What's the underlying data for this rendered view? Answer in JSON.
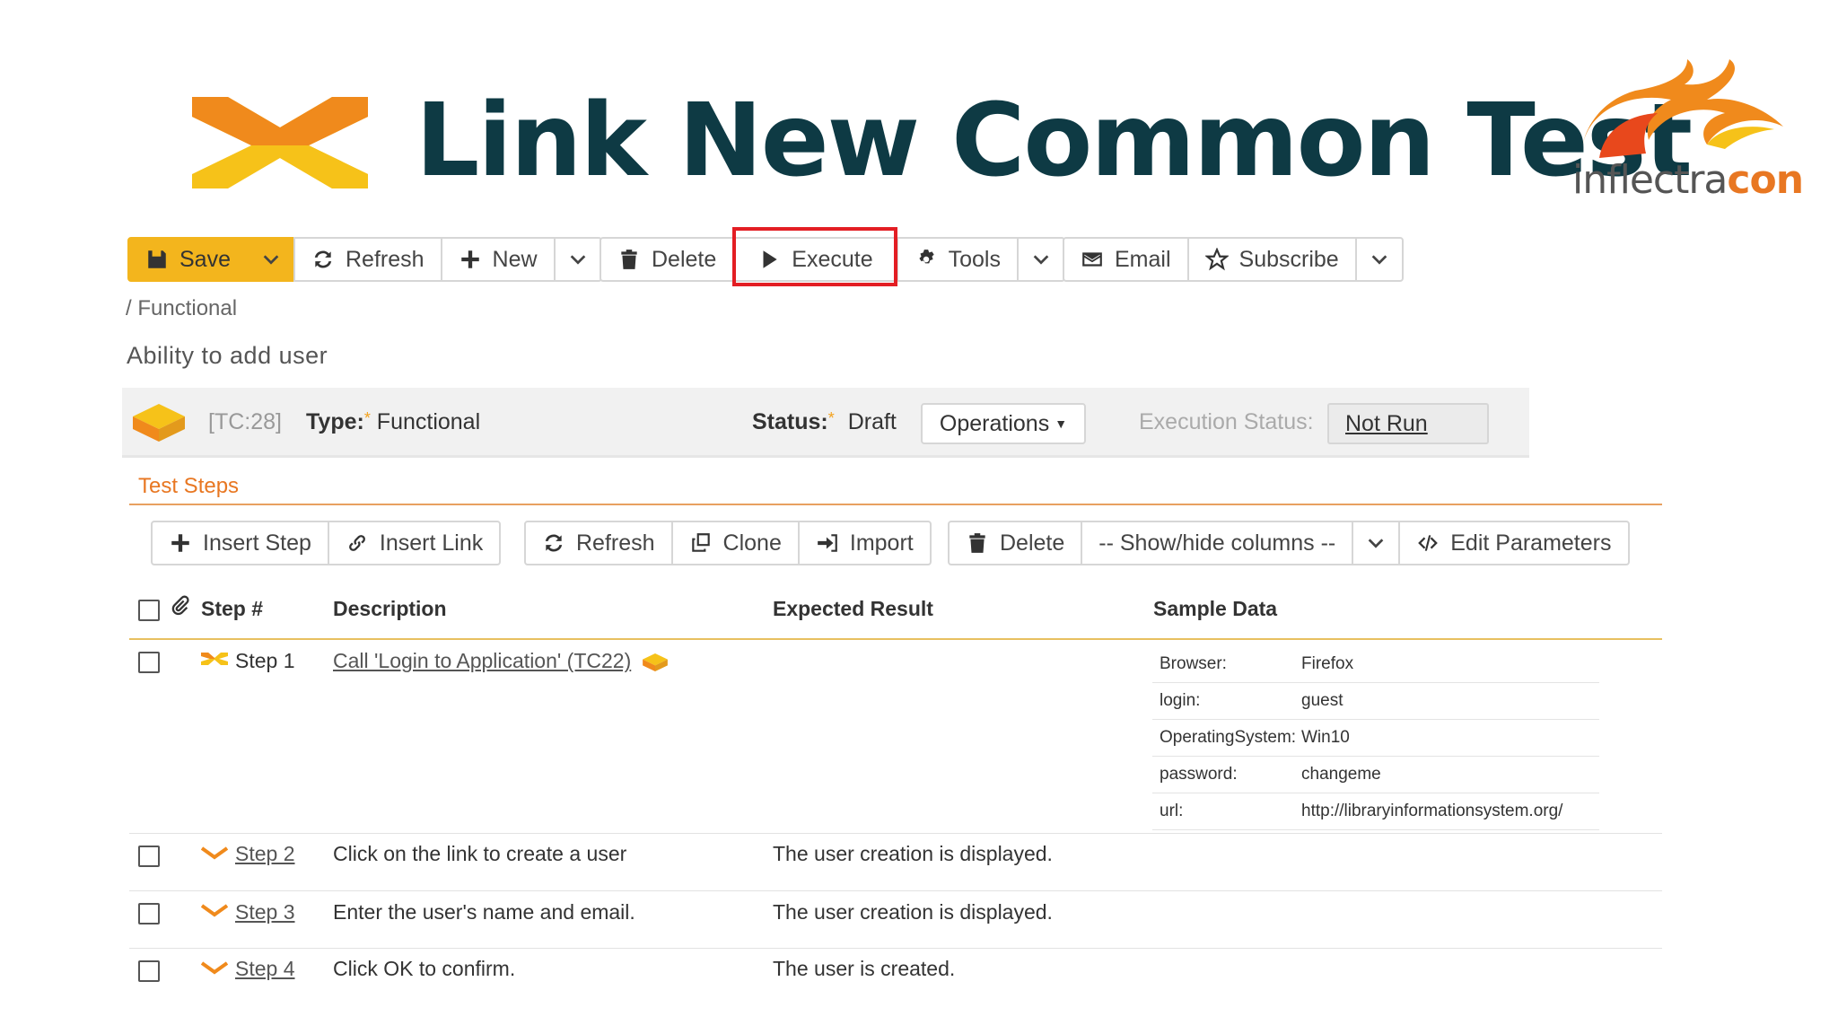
{
  "header": {
    "title": "Link New Common Test",
    "brand_logo": {
      "text_primary": "inflectra",
      "text_accent": "con",
      "colors": {
        "text": "#555555",
        "accent": "#e87722",
        "flame": "#f5a623"
      }
    }
  },
  "toolbar": {
    "save": "Save",
    "refresh": "Refresh",
    "new": "New",
    "delete": "Delete",
    "execute": "Execute",
    "tools": "Tools",
    "email": "Email",
    "subscribe": "Subscribe"
  },
  "breadcrumb": "/ Functional",
  "test_name": "Ability to add user",
  "info": {
    "id": "[TC:28]",
    "type_label": "Type:",
    "type_value": "Functional",
    "status_label": "Status:",
    "status_value": "Draft",
    "operations": "Operations",
    "execution_status_label": "Execution Status:",
    "execution_status_value": "Not Run"
  },
  "steps_tab": "Test Steps",
  "steps_toolbar": {
    "insert_step": "Insert Step",
    "insert_link": "Insert Link",
    "refresh": "Refresh",
    "clone": "Clone",
    "import": "Import",
    "delete": "Delete",
    "show_hide": "-- Show/hide columns --",
    "edit_parameters": "Edit Parameters"
  },
  "table": {
    "columns": [
      "Step #",
      "Description",
      "Expected Result",
      "Sample Data"
    ],
    "rows": [
      {
        "step": "Step 1",
        "description": "Call 'Login to Application' (TC22)",
        "expected": ""
      },
      {
        "step": "Step 2",
        "description": "Click on the link to create a user",
        "expected": "The user creation is displayed."
      },
      {
        "step": "Step 3",
        "description": "Enter the user's name and email.",
        "expected": "The user creation is displayed."
      },
      {
        "step": "Step 4",
        "description": "Click OK to confirm.",
        "expected": "The user is created."
      }
    ],
    "sample_data": [
      {
        "key": "Browser:",
        "value": "Firefox"
      },
      {
        "key": "login:",
        "value": "guest"
      },
      {
        "key": "OperatingSystem:",
        "value": "Win10"
      },
      {
        "key": "password:",
        "value": "changeme"
      },
      {
        "key": "url:",
        "value": "http://libraryinformationsystem.org/"
      }
    ]
  },
  "colors": {
    "accent": "#f3b51d",
    "highlight": "#e31e24",
    "title": "#0e3a44",
    "tab": "#e87722"
  }
}
